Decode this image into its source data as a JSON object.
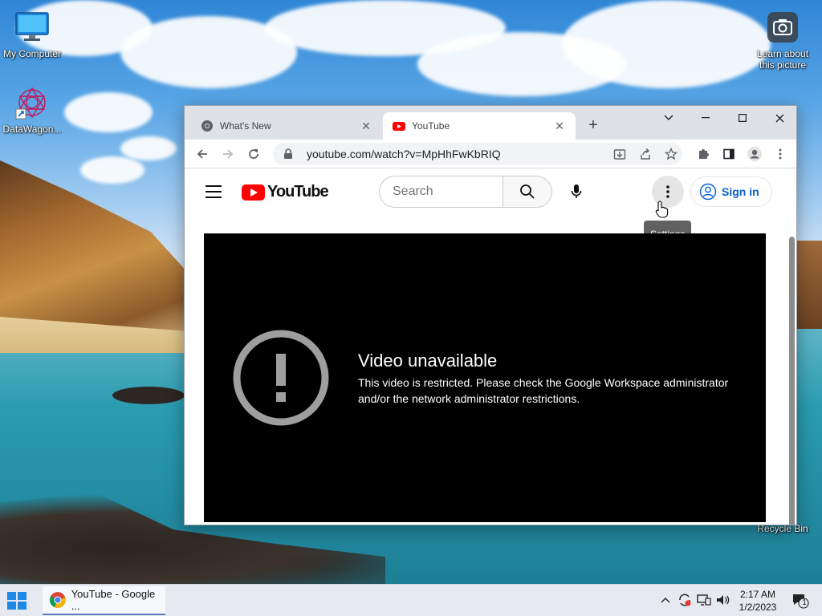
{
  "desktop": {
    "icons": [
      {
        "label": "My Computer"
      },
      {
        "label": "DataWagon..."
      },
      {
        "label": "Learn about this picture"
      },
      {
        "label": "Recycle Bin"
      }
    ]
  },
  "browser": {
    "tabs": [
      {
        "title": "What's New",
        "active": false
      },
      {
        "title": "YouTube",
        "active": true
      }
    ],
    "url": "youtube.com/watch?v=MpHhFwKbRIQ"
  },
  "youtube": {
    "logo_text": "YouTube",
    "search_placeholder": "Search",
    "sign_in_label": "Sign in",
    "tooltip": "Settings",
    "error": {
      "title": "Video unavailable",
      "message": "This video is restricted. Please check the Google Workspace administrator and/or the network administrator restrictions."
    }
  },
  "taskbar": {
    "app_label": "YouTube - Google ...",
    "time": "2:17 AM",
    "date": "1/2/2023",
    "notification_count": "1"
  },
  "colors": {
    "youtube_red": "#ff0000",
    "link_blue": "#065fd4",
    "tab_strip": "#dee1e6"
  }
}
